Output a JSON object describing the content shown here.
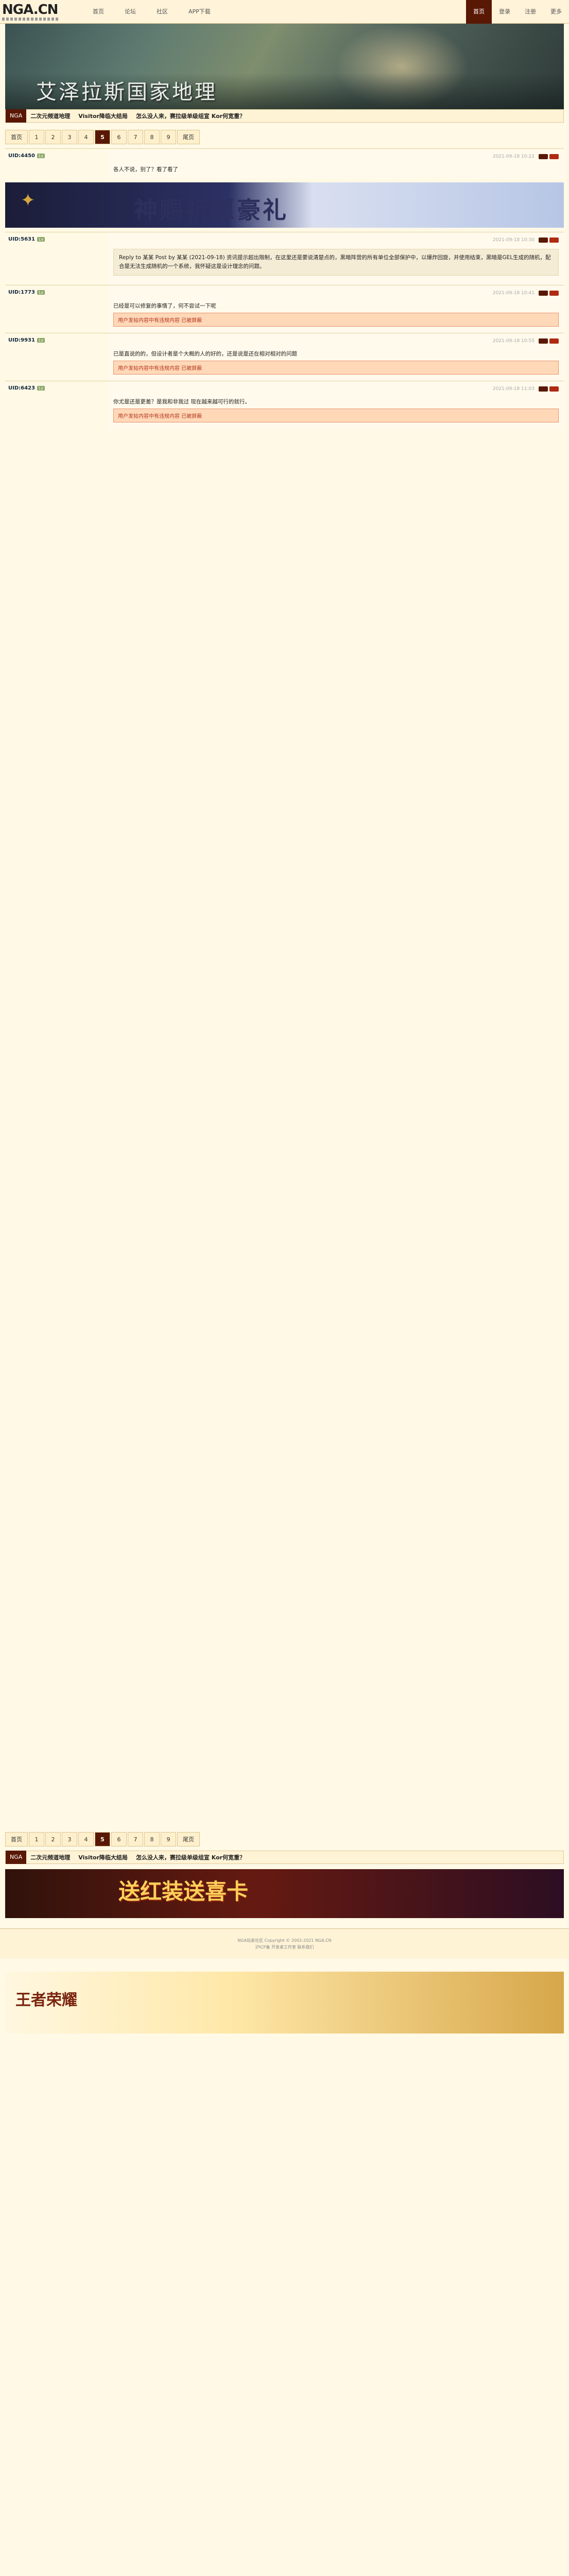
{
  "nav": {
    "logo": "NGA.CN",
    "links": [
      "首页",
      "论坛",
      "社区",
      "APP下载"
    ],
    "right": [
      "首页",
      "登录",
      "注册",
      "更多"
    ]
  },
  "banner": {
    "title": "艾泽拉斯国家地理"
  },
  "subbar": {
    "tag": "NGA",
    "links": [
      "二次元频道地理",
      "Visitor降临大结局",
      "怎么没人来，赛拉级单级组宣 Kor何宽重？"
    ]
  },
  "pager": {
    "items": [
      "首页",
      "1",
      "2",
      "3",
      "4",
      "5",
      "6",
      "7",
      "8",
      "9",
      "尾页"
    ],
    "current": "5"
  },
  "posts": [
    {
      "user": "UID:4450",
      "text": "各人不说，别了？看了看了",
      "date": "2021-09-18 10:22"
    },
    {
      "user": "UID:5631",
      "text": "Reply to 某某 Post by 某某 (2021-09-18) 资讯提示超出限制，在这里还是要说清楚点的，黑暗阵营的所有单位全部保护中，以爆炸回旋，并使用结束，黑暗是GEL生成的随机，配合是无法生成随机的一个系统，我怀疑这是设计理念的问题。",
      "date": "2021-09-18 10:30"
    },
    {
      "user": "UID:1773",
      "text": "已经是可以修复的事情了，何不尝试一下呢",
      "date": "2021-09-18 10:41"
    },
    {
      "user": "UID:9931",
      "text": "已是直说的的，但设计者是个大概的人的好的，还是说是还在相对相对的问题",
      "date": "2021-09-18 10:55"
    },
    {
      "user": "UID:6423",
      "text": "你尤是还是更差？是我和非我过 现在越来越可行的就行。",
      "date": "2021-09-18 11:03"
    }
  ],
  "notices": [
    "用户发帖内容中有违规内容 已被屏蔽",
    "用户发帖内容中有违规内容 已被屏蔽",
    "用户发帖内容中有违规内容 已被屏蔽"
  ],
  "ad1": {
    "text": "神赐祈愿豪礼"
  },
  "ad2": {
    "text": "送红装送喜卡"
  },
  "ad3": {
    "text": "王者荣耀"
  },
  "footer": {
    "line1": "NGA玩家社区 Copyright © 2002-2021 NGA.CN",
    "line2": "沪ICP备 开发者工作室 联系我们"
  }
}
